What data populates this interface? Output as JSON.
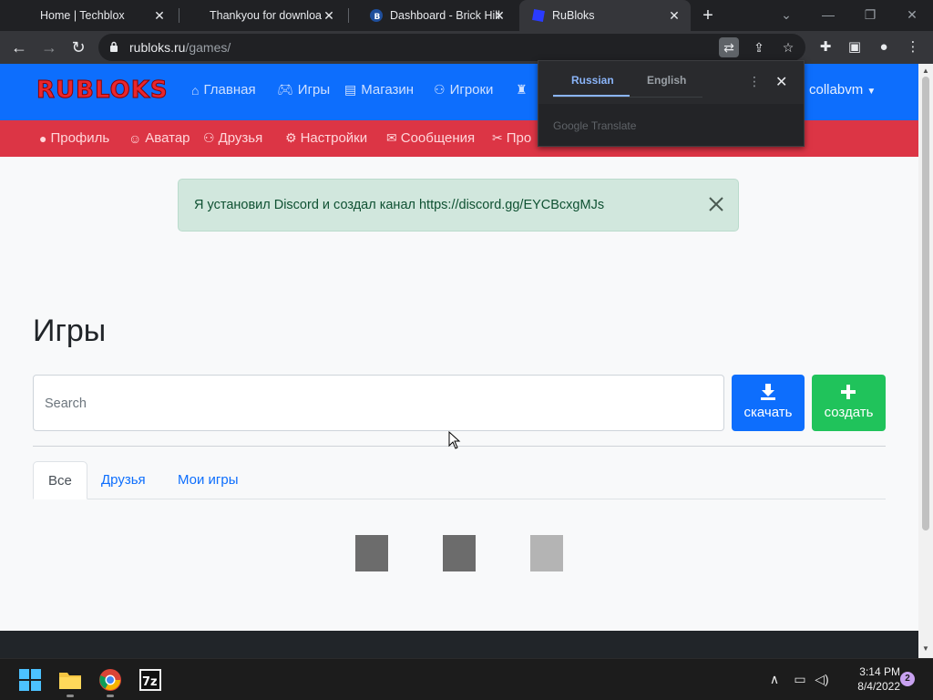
{
  "browser": {
    "tabs": [
      {
        "title": "Home | Techblox"
      },
      {
        "title": "Thankyou for downloa"
      },
      {
        "title": "Dashboard - Brick Hill"
      },
      {
        "title": "RuBloks"
      }
    ],
    "url_host": "rubloks.ru",
    "url_path": "/games/"
  },
  "translate_popup": {
    "tab_from": "Russian",
    "tab_to": "English",
    "footer": "Google Translate"
  },
  "site": {
    "logo_text": "RUBLOKS",
    "nav": [
      {
        "label": "Главная",
        "icon": "home-icon"
      },
      {
        "label": "Игры",
        "icon": "gamepad-icon"
      },
      {
        "label": "Магазин",
        "icon": "store-icon"
      },
      {
        "label": "Игроки",
        "icon": "users-icon"
      }
    ],
    "user_label": "collabvm",
    "subnav": [
      {
        "label": "Профиль",
        "icon": "user-icon"
      },
      {
        "label": "Аватар",
        "icon": "avatar-icon"
      },
      {
        "label": "Друзья",
        "icon": "friends-icon"
      },
      {
        "label": "Настройки",
        "icon": "gear-icon"
      },
      {
        "label": "Сообщения",
        "icon": "envelope-icon"
      },
      {
        "label": "Про",
        "icon": "tools-icon"
      }
    ],
    "colors": {
      "topnav": "#0d6efd",
      "subnav": "#dc3545",
      "alert_bg": "#d1e7dd",
      "create_btn": "#20c35b"
    }
  },
  "alert": {
    "message": "Я установил Discord и создал канал https://discord.gg/EYCBcxgMJs"
  },
  "games": {
    "title": "Игры",
    "search_placeholder": "Search",
    "download_label": "скачать",
    "create_label": "создать",
    "tabs": [
      "Все",
      "Друзья",
      "Мои игры"
    ],
    "active_tab": "Все"
  },
  "taskbar": {
    "time": "3:14 PM",
    "date": "8/4/2022",
    "notification_count": "2"
  }
}
